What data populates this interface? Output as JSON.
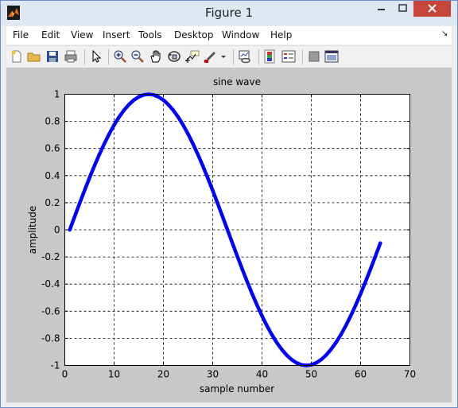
{
  "window": {
    "title": "Figure 1"
  },
  "menu": {
    "items": [
      "File",
      "Edit",
      "View",
      "Insert",
      "Tools",
      "Desktop",
      "Window",
      "Help"
    ],
    "dock_arrow": "↘"
  },
  "toolbar": {
    "icons": [
      "new-figure-icon",
      "open-file-icon",
      "save-icon",
      "print-icon",
      "edit-plot-arrow-icon",
      "zoom-in-icon",
      "zoom-out-icon",
      "pan-hand-icon",
      "rotate-3d-icon",
      "data-cursor-icon",
      "brush-icon",
      "brush-dropdown-icon",
      "link-plot-icon",
      "colorbar-icon",
      "legend-icon",
      "hide-plot-tools-icon",
      "show-plot-tools-icon"
    ]
  },
  "colors": {
    "line": "#0000ff",
    "figure_bg": "#c8c8c8",
    "axes_bg": "#ffffff"
  },
  "chart_data": {
    "type": "line",
    "title": "sine wave",
    "xlabel": "sample number",
    "ylabel": "amplitude",
    "xlim": [
      0,
      70
    ],
    "ylim": [
      -1,
      1
    ],
    "xticks": [
      0,
      10,
      20,
      30,
      40,
      50,
      60,
      70
    ],
    "yticks": [
      -1,
      -0.8,
      -0.6,
      -0.4,
      -0.2,
      0,
      0.2,
      0.4,
      0.6,
      0.8,
      1
    ],
    "grid": true,
    "series": [
      {
        "color": "#0000ff",
        "x": [
          1,
          2,
          3,
          4,
          5,
          6,
          7,
          8,
          9,
          10,
          11,
          12,
          13,
          14,
          15,
          16,
          17,
          18,
          19,
          20,
          21,
          22,
          23,
          24,
          25,
          26,
          27,
          28,
          29,
          30,
          31,
          32,
          33,
          34,
          35,
          36,
          37,
          38,
          39,
          40,
          41,
          42,
          43,
          44,
          45,
          46,
          47,
          48,
          49,
          50,
          51,
          52,
          53,
          54,
          55,
          56,
          57,
          58,
          59,
          60,
          61,
          62,
          63,
          64
        ],
        "y": [
          0,
          0.098,
          0.1951,
          0.2903,
          0.3827,
          0.4714,
          0.5556,
          0.6344,
          0.7071,
          0.773,
          0.8315,
          0.8819,
          0.9239,
          0.9569,
          0.9808,
          0.9952,
          1.0,
          0.9952,
          0.9808,
          0.9569,
          0.9239,
          0.8819,
          0.8315,
          0.773,
          0.7071,
          0.6344,
          0.5556,
          0.4714,
          0.3827,
          0.2903,
          0.1951,
          0.098,
          0,
          -0.098,
          -0.1951,
          -0.2903,
          -0.3827,
          -0.4714,
          -0.5556,
          -0.6344,
          -0.7071,
          -0.773,
          -0.8315,
          -0.8819,
          -0.9239,
          -0.9569,
          -0.9808,
          -0.9952,
          -1.0,
          -0.9952,
          -0.9808,
          -0.9569,
          -0.9239,
          -0.8819,
          -0.8315,
          -0.773,
          -0.7071,
          -0.6344,
          -0.5556,
          -0.4714,
          -0.3827,
          -0.2903,
          -0.1951,
          -0.098
        ]
      }
    ]
  }
}
